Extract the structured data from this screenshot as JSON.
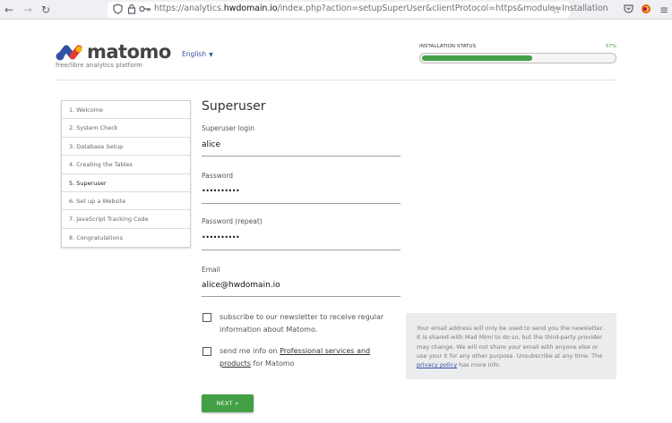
{
  "browser": {
    "url_prefix": "https://analytics.",
    "url_host": "hwdomain.io",
    "url_path": "/index.php?action=setupSuperUser&clientProtocol=https&module=Installation",
    "icons": [
      "back-arrow",
      "forward-arrow",
      "reload",
      "shield",
      "lock",
      "key",
      "star",
      "pocket",
      "firefox-account",
      "menu"
    ]
  },
  "header": {
    "logo_text": "matomo",
    "tagline": "free/libre analytics platform",
    "language": "English",
    "status_label": "INSTALLATION STATUS",
    "status_percent_text": "57%",
    "status_percent": 57
  },
  "steps": [
    {
      "label": "1. Welcome",
      "active": false
    },
    {
      "label": "2. System Check",
      "active": false
    },
    {
      "label": "3. Database Setup",
      "active": false
    },
    {
      "label": "4. Creating the Tables",
      "active": false
    },
    {
      "label": "5. Superuser",
      "active": true
    },
    {
      "label": "6. Set up a Website",
      "active": false
    },
    {
      "label": "7. JavaScript Tracking Code",
      "active": false
    },
    {
      "label": "8. Congratulations",
      "active": false
    }
  ],
  "form": {
    "heading": "Superuser",
    "login_label": "Superuser login",
    "login_value": "alice",
    "password_label": "Password",
    "password_value": "••••••••••",
    "password_repeat_label": "Password (repeat)",
    "password_repeat_value": "••••••••••",
    "email_label": "Email",
    "email_value": "alice@hwdomain.io",
    "newsletter_text": "subscribe to our newsletter to receive regular information about Matomo.",
    "pro_text_before": "send me info on ",
    "pro_link": "Professional services and products",
    "pro_text_after": " for Matomo",
    "next_label": "NEXT »"
  },
  "info": {
    "text_before": "Your email address will only be used to send you the newsletter. It is shared with Mad Mimi to do so, but the third-party provider may change. We will not share your email with anyone else or use your it for any other purpose. Unsubscribe at any time. The ",
    "link": "privacy policy",
    "text_after": " has more info."
  },
  "colors": {
    "accent_green": "#43a047",
    "link_blue": "#3450a3",
    "logo_blue": "#3450a3",
    "logo_red": "#e53935",
    "logo_yellow": "#f4b400"
  }
}
